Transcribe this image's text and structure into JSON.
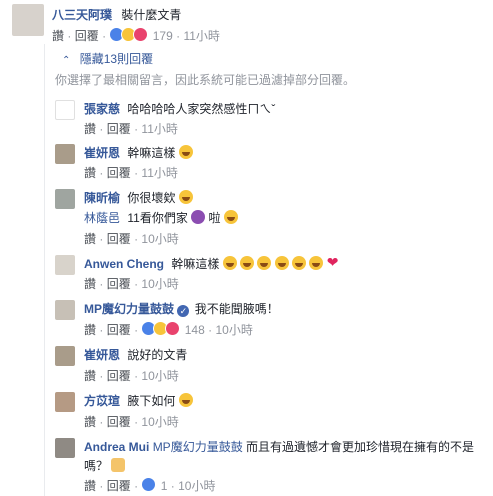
{
  "top_comment": {
    "author": "八三天阿璞",
    "text": "裝什麼文青",
    "like": "讚",
    "reply": "回覆",
    "reaction_count": "179",
    "time": "11小時"
  },
  "hidden": {
    "toggle": "隱藏13則回覆",
    "notice": "你選擇了最相關留言，因此系統可能已過濾掉部分回覆。"
  },
  "replies": [
    {
      "author": "張家慈",
      "text": "哈哈哈哈人家突然感性ㄇㄟˇ",
      "like": "讚",
      "reply": "回覆",
      "time": "11小時"
    },
    {
      "author": "崔妍恩",
      "text": "幹嘛這樣",
      "like": "讚",
      "reply": "回覆",
      "time": "11小時"
    },
    {
      "author": "陳昕榆",
      "text": "你很壞欸",
      "mention": "林蔭邑",
      "text2a": "11看你們家",
      "text2b": "啦",
      "like": "讚",
      "reply": "回覆",
      "time": "10小時"
    },
    {
      "author": "Anwen Cheng",
      "text": "幹嘛這樣",
      "like": "讚",
      "reply": "回覆",
      "time": "10小時"
    },
    {
      "author": "MP魔幻力量鼓鼓",
      "text": "我不能聞腋嗎！",
      "like": "讚",
      "reply": "回覆",
      "reaction_count": "148",
      "time": "10小時"
    },
    {
      "author": "崔妍恩",
      "text": "說好的文青",
      "like": "讚",
      "reply": "回覆",
      "time": "10小時"
    },
    {
      "author": "方苡瑄",
      "text": "腋下如何",
      "like": "讚",
      "reply": "回覆",
      "time": "10小時"
    },
    {
      "author": "Andrea Mui",
      "mention": "MP魔幻力量鼓鼓",
      "text": "而且有過遺憾才會更加珍惜現在擁有的不是嗎？",
      "like": "讚",
      "reply": "回覆",
      "reaction_count": "1",
      "time": "10小時"
    }
  ],
  "separator": "·"
}
